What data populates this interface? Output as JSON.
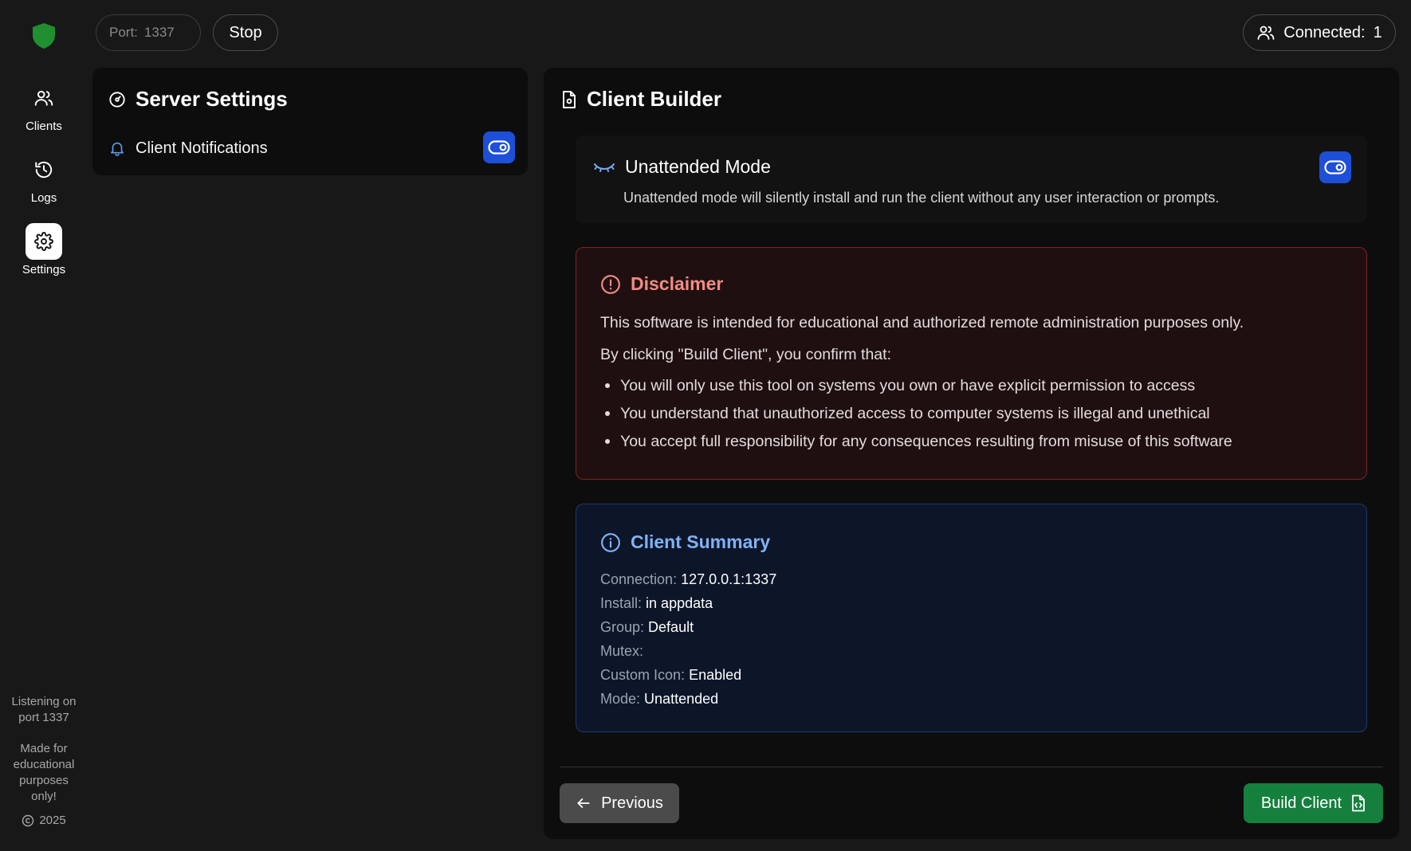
{
  "colors": {
    "background": "#181818",
    "panel": "#0d0d0d",
    "accent_blue": "#1d4fd8",
    "brand_green": "#15803d",
    "logo_green": "#1f8f2f",
    "danger_text": "#f28b82",
    "info_text": "#7fb3f5"
  },
  "sidebar": {
    "items": [
      {
        "label": "Clients",
        "icon": "users-icon",
        "active": false
      },
      {
        "label": "Logs",
        "icon": "history-icon",
        "active": false
      },
      {
        "label": "Settings",
        "icon": "gear-icon",
        "active": true
      }
    ],
    "footer": {
      "listening": "Listening on port 1337",
      "made_for": "Made for educational purposes only!",
      "copyright": "2025"
    }
  },
  "topbar": {
    "port_label": "Port:",
    "port_value": "1337",
    "stop_label": "Stop",
    "connected_label": "Connected:",
    "connected_count": "1"
  },
  "server_settings": {
    "title": "Server Settings",
    "notifications_label": "Client Notifications",
    "notifications_enabled": true
  },
  "client_builder": {
    "title": "Client Builder",
    "unattended": {
      "title": "Unattended Mode",
      "description": "Unattended mode will silently install and run the client without any user interaction or prompts.",
      "enabled": true
    },
    "disclaimer": {
      "title": "Disclaimer",
      "intro": "This software is intended for educational and authorized remote administration purposes only.",
      "confirm": "By clicking \"Build Client\", you confirm that:",
      "items": [
        "You will only use this tool on systems you own or have explicit permission to access",
        "You understand that unauthorized access to computer systems is illegal and unethical",
        "You accept full responsibility for any consequences resulting from misuse of this software"
      ]
    },
    "summary": {
      "title": "Client Summary",
      "rows": [
        {
          "key": "Connection:",
          "value": "127.0.0.1:1337"
        },
        {
          "key": "Install:",
          "value": "in appdata"
        },
        {
          "key": "Group:",
          "value": "Default"
        },
        {
          "key": "Mutex:",
          "value": ""
        },
        {
          "key": "Custom Icon:",
          "value": "Enabled"
        },
        {
          "key": "Mode:",
          "value": "Unattended"
        }
      ]
    },
    "previous_label": "Previous",
    "build_label": "Build Client"
  }
}
